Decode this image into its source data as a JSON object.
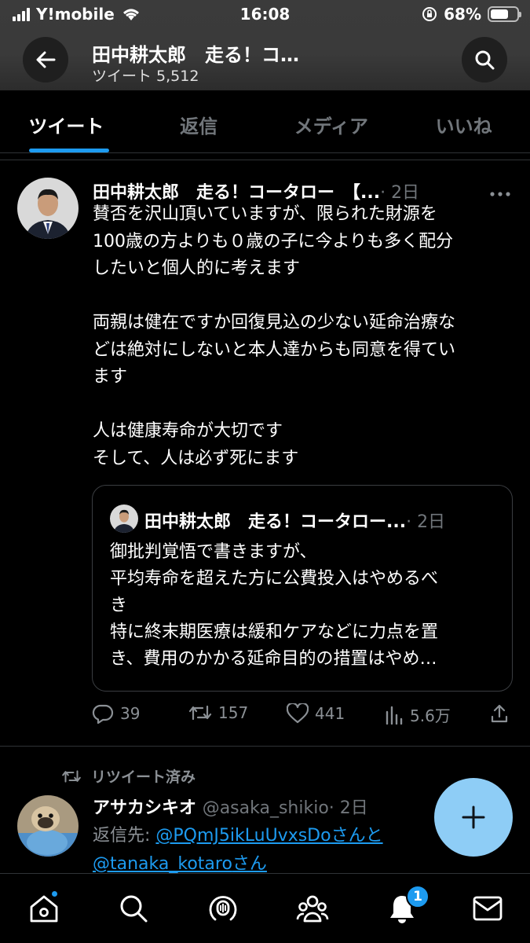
{
  "status_bar": {
    "carrier": "Y!mobile",
    "time": "16:08",
    "battery_percent": "68%",
    "battery_level": 0.68
  },
  "header": {
    "title": "田中耕太郎　走る！コ…",
    "subtitle": "ツイート 5,512"
  },
  "tabs": [
    {
      "label": "ツイート",
      "active": true
    },
    {
      "label": "返信",
      "active": false
    },
    {
      "label": "メディア",
      "active": false
    },
    {
      "label": "いいね",
      "active": false
    }
  ],
  "tweet": {
    "author": "田中耕太郎　走る！コータロー　【...",
    "time": "· 2日",
    "body": "賛否を沢山頂いていますが、限られた財源を\n100歳の方よりも０歳の子に今よりも多く配分\nしたいと個人的に考えます\n\n両親は健在ですか回復見込の少ない延命治療な\nどは絶対にしないと本人達からも同意を得てい\nます\n\n人は健康寿命が大切です\nそして、人は必ず死にます",
    "quote": {
      "author": "田中耕太郎　走る！コータロー...",
      "time": "· 2日",
      "body": "御批判覚悟で書きますが、\n平均寿命を超えた方に公費投入はやめるべ\nき\n特に終末期医療は緩和ケアなどに力点を置\nき、費用のかかる延命目的の措置はやめ…"
    },
    "stats": {
      "replies": "39",
      "retweets": "157",
      "likes": "441",
      "views": "5.6万"
    }
  },
  "tweet2": {
    "retweet_label": "リツイート済み",
    "author": "アサカシキオ",
    "handle": "@asaka_shikio",
    "time": "· 2日",
    "reply_prefix": "返信先: ",
    "reply_user1": "@PQmJ5ikLuUvxsDo",
    "reply_san1": "さんと",
    "reply_user2": "@tanaka_kotaro",
    "reply_san2": "さん"
  },
  "nav": {
    "notification_count": "1"
  },
  "colors": {
    "accent": "#1d9bf0",
    "fab": "#8ecdf6",
    "background": "#000000",
    "muted": "#71767b"
  }
}
